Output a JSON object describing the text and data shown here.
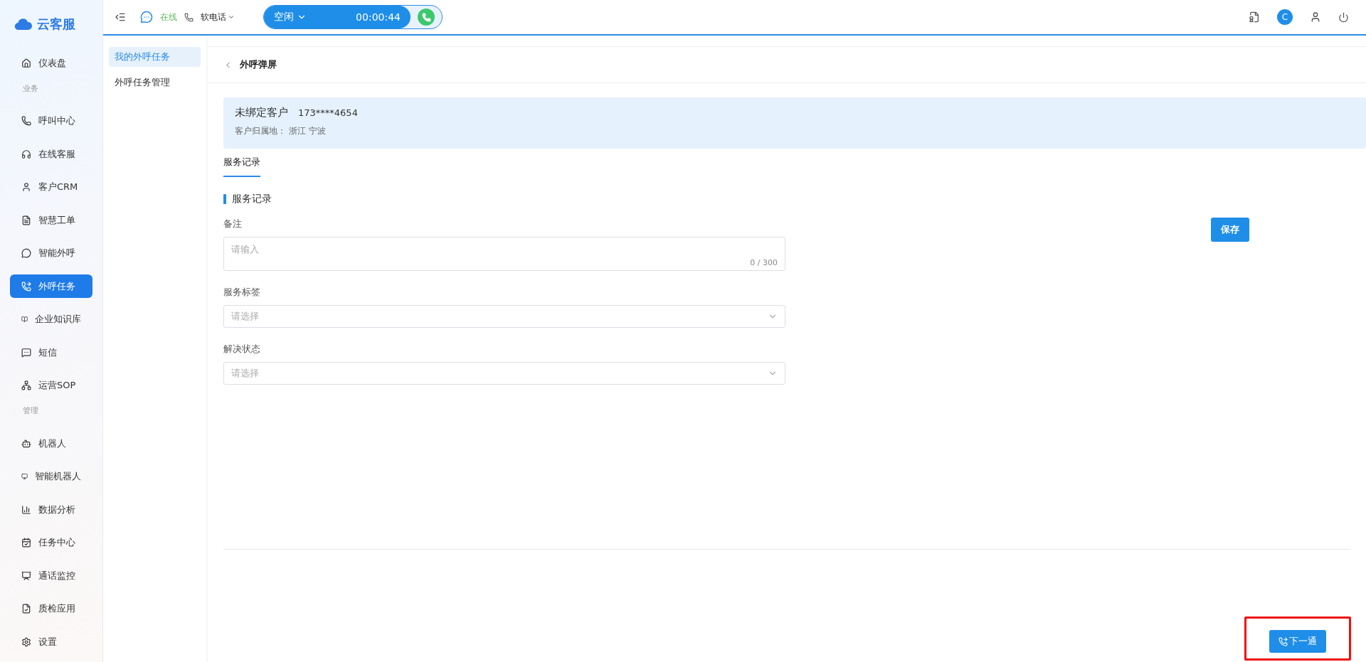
{
  "brand": {
    "name": "云客服"
  },
  "sidebar": {
    "items": [
      {
        "kind": "item",
        "label": "仪表盘",
        "selected": false
      },
      {
        "kind": "section",
        "label": "业务"
      },
      {
        "kind": "item",
        "label": "呼叫中心",
        "selected": false
      },
      {
        "kind": "item",
        "label": "在线客服",
        "selected": false
      },
      {
        "kind": "item",
        "label": "客户CRM",
        "selected": false
      },
      {
        "kind": "item",
        "label": "智慧工单",
        "selected": false
      },
      {
        "kind": "item",
        "label": "智能外呼",
        "selected": false
      },
      {
        "kind": "item",
        "label": "外呼任务",
        "selected": true
      },
      {
        "kind": "item",
        "label": "企业知识库",
        "selected": false
      },
      {
        "kind": "item",
        "label": "短信",
        "selected": false
      },
      {
        "kind": "item",
        "label": "运营SOP",
        "selected": false
      },
      {
        "kind": "section",
        "label": "管理"
      },
      {
        "kind": "item",
        "label": "机器人",
        "selected": false
      },
      {
        "kind": "item",
        "label": "智能机器人",
        "selected": false
      },
      {
        "kind": "item",
        "label": "数据分析",
        "selected": false
      },
      {
        "kind": "item",
        "label": "任务中心",
        "selected": false
      },
      {
        "kind": "item",
        "label": "通话监控",
        "selected": false
      },
      {
        "kind": "item",
        "label": "质检应用",
        "selected": false
      },
      {
        "kind": "item",
        "label": "设置",
        "selected": false
      }
    ]
  },
  "topbar": {
    "status": "在线",
    "phone_mode": "软电话",
    "agent_state": "空闲",
    "timer": "00:00:44",
    "avatar": "C"
  },
  "subnav": {
    "items": [
      {
        "label": "我的外呼任务",
        "selected": true
      },
      {
        "label": "外呼任务管理",
        "selected": false
      }
    ]
  },
  "page": {
    "title": "外呼弹屏",
    "customer": {
      "name": "未绑定客户",
      "phone": "173****4654",
      "location_label": "客户归属地：",
      "location": "浙江 宁波"
    },
    "tabs": [
      {
        "label": "服务记录",
        "selected": true
      }
    ],
    "section_title": "服务记录",
    "form": {
      "fields": [
        {
          "kind": "textarea",
          "label": "备注",
          "placeholder": "请输入",
          "counter": "0 / 300"
        },
        {
          "kind": "select",
          "label": "服务标签",
          "placeholder": "请选择"
        },
        {
          "kind": "select",
          "label": "解决状态",
          "placeholder": "请选择"
        }
      ],
      "save_button": "保存"
    },
    "next_button": "下一通"
  }
}
